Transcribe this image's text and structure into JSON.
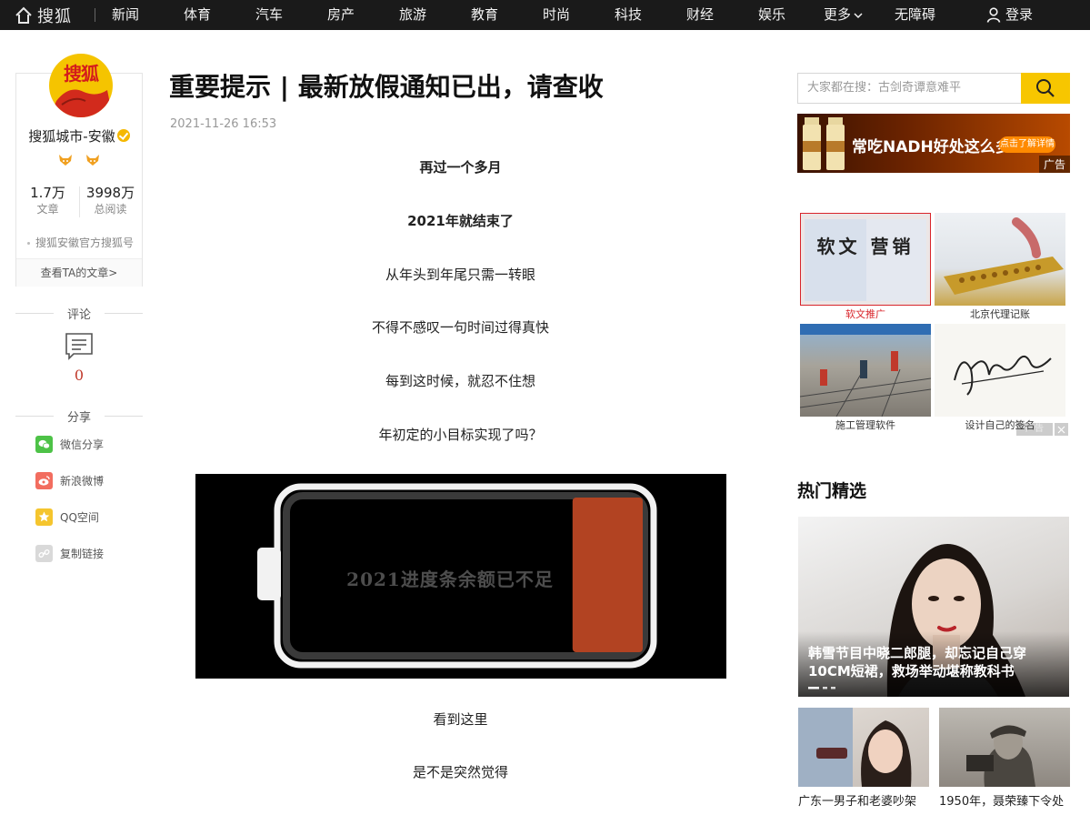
{
  "nav": {
    "logo_text": "搜狐",
    "items": [
      "新闻",
      "体育",
      "汽车",
      "房产",
      "旅游",
      "教育",
      "时尚",
      "科技",
      "财经",
      "娱乐",
      "更多",
      "无障碍"
    ],
    "login": "登录"
  },
  "author": {
    "avatar_text": "搜狐",
    "name": "搜狐城市-安徽",
    "articles_count": "1.7万",
    "articles_label": "文章",
    "reads_count": "3998万",
    "reads_label": "总阅读",
    "desc": "搜狐安徽官方搜狐号",
    "link": "查看TA的文章>"
  },
  "comments": {
    "label": "评论",
    "count": "0"
  },
  "share": {
    "label": "分享",
    "items": [
      "微信分享",
      "新浪微博",
      "QQ空间",
      "复制链接"
    ]
  },
  "article": {
    "title": "重要提示 | 最新放假通知已出，请查收",
    "date": "2021-11-26 16:53",
    "paragraphs": [
      "再过一个多月",
      "2021年就结束了",
      "从年头到年尾只需一转眼",
      "不得不感叹一句时间过得真快",
      "每到这时候，就忍不住想",
      "年初定的小目标实现了吗？",
      "看到这里",
      "是不是突然觉得"
    ],
    "image_text": "2021进度条余额已不足",
    "battery_level": 0.2
  },
  "sidebar": {
    "search_placeholder": "大家都在搜：古剑奇谭意难平",
    "banner": {
      "text": "常吃NADH好处这么多",
      "button": "点击了解详情",
      "tag": "广告",
      "brand": "NADH"
    },
    "grid_ads": [
      {
        "caption": "软文推广",
        "img_text": "软文 营销",
        "highlight": true
      },
      {
        "caption": "北京代理记账"
      },
      {
        "caption": "施工管理软件"
      },
      {
        "caption": "设计自己的签名"
      }
    ],
    "grid_ad_tag": "广告",
    "hot_title": "热门精选",
    "feature": {
      "caption": "韩雪节目中晓二郎腿，却忘记自己穿10CM短裙，救场举动堪称教科书"
    },
    "thumbs": [
      {
        "caption": "广东一男子和老婆吵架"
      },
      {
        "caption": "1950年，聂荣臻下令处"
      }
    ]
  },
  "colors": {
    "nav_bg": "#1a1a1a",
    "accent_yellow": "#f7c600",
    "comment_red": "#c0392b"
  }
}
